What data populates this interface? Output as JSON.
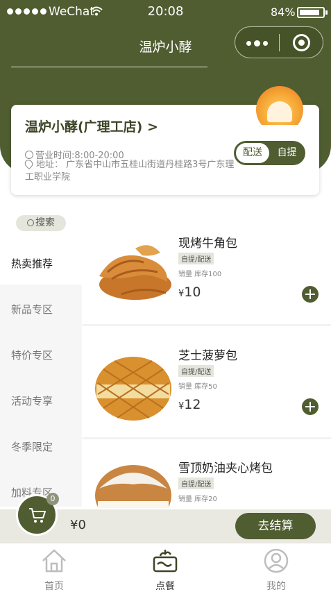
{
  "status_bar": {
    "carrier": "WeChat",
    "time": "20:08",
    "battery": "84%",
    "battery_level": 0.84
  },
  "nav": {
    "title": "温炉小酵"
  },
  "store": {
    "name": "温炉小酵(广理工店)",
    "chevron": ">",
    "hours": "营业时间:8:00-20:00",
    "address": "地址： 广东省中山市五桂山街道丹桂路3号广东理工职业学院",
    "modes": [
      "配送",
      "自提"
    ],
    "selected_mode": "配送"
  },
  "sidebar": {
    "search_label": "搜索",
    "categories": [
      "热卖推荐",
      "新品专区",
      "特价专区",
      "活动专享",
      "冬季限定",
      "加料专区"
    ],
    "active_category": "热卖推荐"
  },
  "products": [
    {
      "name": "现烤牛角包",
      "tag": "自提/配送",
      "meta": "销量 库存100",
      "currency": "¥",
      "price": "10"
    },
    {
      "name": "芝士菠萝包",
      "tag": "自提/配送",
      "meta": "销量 库存50",
      "currency": "¥",
      "price": "12"
    },
    {
      "name": "雪顶奶油夹心烤包",
      "tag": "自提/配送",
      "meta": "销量 库存20",
      "currency": "¥",
      "price": ""
    }
  ],
  "cart": {
    "count": "0",
    "total": "¥0",
    "checkout_label": "去结算"
  },
  "tabs": [
    {
      "label": "首页",
      "icon": "home-icon"
    },
    {
      "label": "点餐",
      "icon": "order-icon"
    },
    {
      "label": "我的",
      "icon": "profile-icon"
    }
  ],
  "active_tab": "点餐",
  "colors": {
    "brand": "#4f5d31",
    "tag_bg": "#e4e6dc",
    "cart_bar": "#e9e9e1",
    "logo_orange": "#f5a533"
  }
}
